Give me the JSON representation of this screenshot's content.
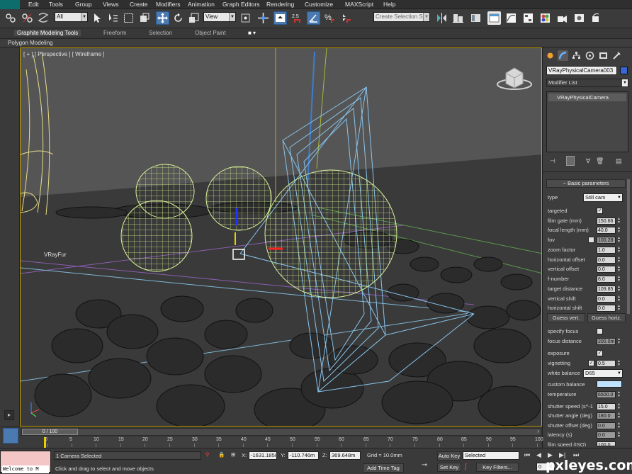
{
  "menu": {
    "logo": "",
    "items": [
      "Edit",
      "Tools",
      "Group",
      "Views",
      "Create",
      "Modifiers",
      "Animation",
      "Graph Editors",
      "Rendering",
      "Customize",
      "MAXScript",
      "Help"
    ]
  },
  "toolbar": {
    "selection_filter": "All",
    "ref_coord": "View",
    "snap_value": "2.5",
    "named_selection_placeholder": "Create Selection Se"
  },
  "ribbon": {
    "tabs": [
      "Graphite Modeling Tools",
      "Freeform",
      "Selection",
      "Object Paint"
    ],
    "active_tab": "Graphite Modeling Tools",
    "sub_label": "Polygon Modeling"
  },
  "viewport": {
    "label": "[ + ] [ Perspective ] [ Wireframe ]",
    "object_label": "VRayFur"
  },
  "command_panel": {
    "object_name": "VRayPhysicalCamera003",
    "object_color": "#3a66d4",
    "modifier_list": "Modifier List",
    "stack_item": "VRayPhysicalCamera",
    "rollout_title": "Basic parameters",
    "params": {
      "type_label": "type",
      "type_value": "Still cam",
      "targeted_label": "targeted",
      "targeted": true,
      "film_gate_label": "film gate (mm)",
      "film_gate": "150.66",
      "focal_length_label": "focal length (mm)",
      "focal_length": "40.0",
      "fov_label": "fov",
      "fov": "100.28",
      "zoom_factor_label": "zoom factor",
      "zoom_factor": "1.0",
      "h_offset_label": "horizontal offset",
      "h_offset": "0.0",
      "v_offset_label": "vertical offset",
      "v_offset": "0.0",
      "f_number_label": "f-number",
      "f_number": "8.0",
      "target_distance_label": "target distance",
      "target_distance": "109.85",
      "v_shift_label": "vertical shift",
      "v_shift": "0.0",
      "h_shift_label": "horizontal shift",
      "h_shift": "0.0",
      "guess_vert": "Guess vert.",
      "guess_horiz": "Guess horiz.",
      "specify_focus_label": "specify focus",
      "focus_distance_label": "focus distance",
      "focus_distance": "200.0m",
      "exposure_label": "exposure",
      "vignetting_label": "vignetting",
      "vignetting": "0.5",
      "white_balance_label": "white balance",
      "white_balance": "D65",
      "custom_balance_label": "custom balance",
      "custom_balance_color": "#bfe3ff",
      "temperature_label": "temperature",
      "temperature": "6500.0",
      "shutter_speed_label": "shutter speed (s^-1",
      "shutter_speed": "15.0",
      "shutter_angle_label": "shutter angle (deg)",
      "shutter_angle": "180.0",
      "shutter_offset_label": "shutter offset (deg)",
      "shutter_offset": "0.0",
      "latency_label": "latency (s)",
      "latency": "0.0",
      "film_speed_label": "film speed (ISO)",
      "film_speed": "100.0"
    }
  },
  "timeline": {
    "slider_text": "0 / 100",
    "ticks": [
      "0",
      "5",
      "10",
      "15",
      "20",
      "25",
      "30",
      "35",
      "40",
      "45",
      "50",
      "55",
      "60",
      "65",
      "70",
      "75",
      "80",
      "85",
      "90",
      "95",
      "100"
    ]
  },
  "status": {
    "maxscript": "Welcome to M",
    "selected_count": "1 Camera Selected",
    "prompt": "Click and drag to select and move objects",
    "x_label": "X:",
    "x_value": "-1631.185i",
    "y_label": "Y:",
    "y_value": "-110.746m",
    "z_label": "Z:",
    "z_value": "369.648m",
    "grid": "Grid = 10.0mm",
    "add_time_tag": "Add Time Tag",
    "auto_key": "Auto Key",
    "set_key": "Set Key",
    "key_mode": "Selected",
    "key_filters": "Key Filters...",
    "frame": "0"
  },
  "watermark": "pxleyes.com"
}
